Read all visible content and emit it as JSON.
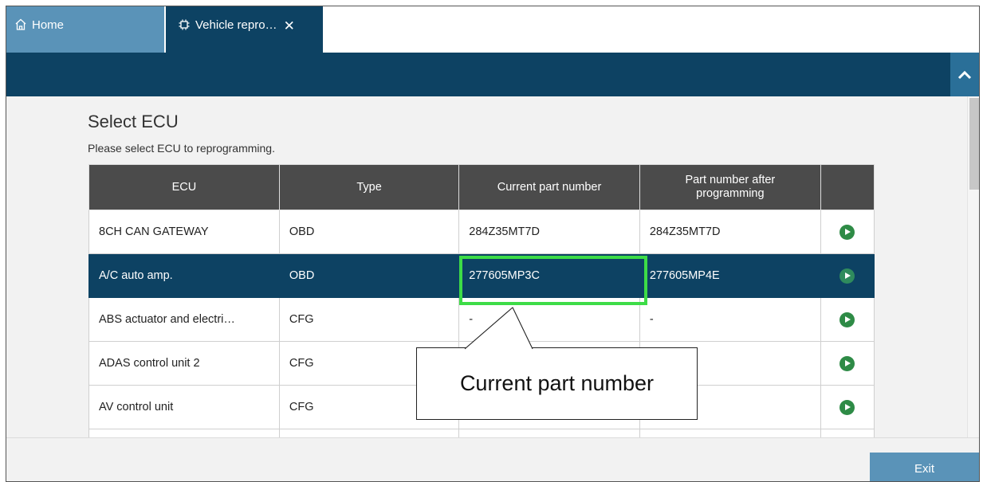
{
  "tabs": {
    "home_label": "Home",
    "vehicle_label": "Vehicle repro…",
    "close_glyph": "✕"
  },
  "page": {
    "title": "Select ECU",
    "subtitle": "Please select ECU to reprogramming."
  },
  "table": {
    "headers": [
      "ECU",
      "Type",
      "Current part number",
      "Part number after programming"
    ],
    "rows": [
      {
        "ecu": "8CH CAN GATEWAY",
        "type": "OBD",
        "current": "284Z35MT7D",
        "after": "284Z35MT7D"
      },
      {
        "ecu": "A/C auto amp.",
        "type": "OBD",
        "current": "277605MP3C",
        "after": "277605MP4E"
      },
      {
        "ecu": "ABS actuator and electri…",
        "type": "CFG",
        "current": "-",
        "after": "-"
      },
      {
        "ecu": "ADAS control unit 2",
        "type": "CFG",
        "current": "",
        "after": ""
      },
      {
        "ecu": "AV control unit",
        "type": "CFG",
        "current": "",
        "after": ""
      },
      {
        "ecu": "",
        "type": "",
        "current": "",
        "after": ""
      }
    ]
  },
  "callout": {
    "text": "Current part number"
  },
  "footer": {
    "exit_label": "Exit"
  },
  "icons": {
    "home": "home-icon",
    "chip": "chip-icon",
    "collapse": "chevron-up-icon",
    "run": "play-circle-icon"
  },
  "colors": {
    "navy": "#0d4263",
    "tab_blue": "#5a93b8",
    "highlight_green": "#3ddc47",
    "run_green": "#2e8b46"
  }
}
